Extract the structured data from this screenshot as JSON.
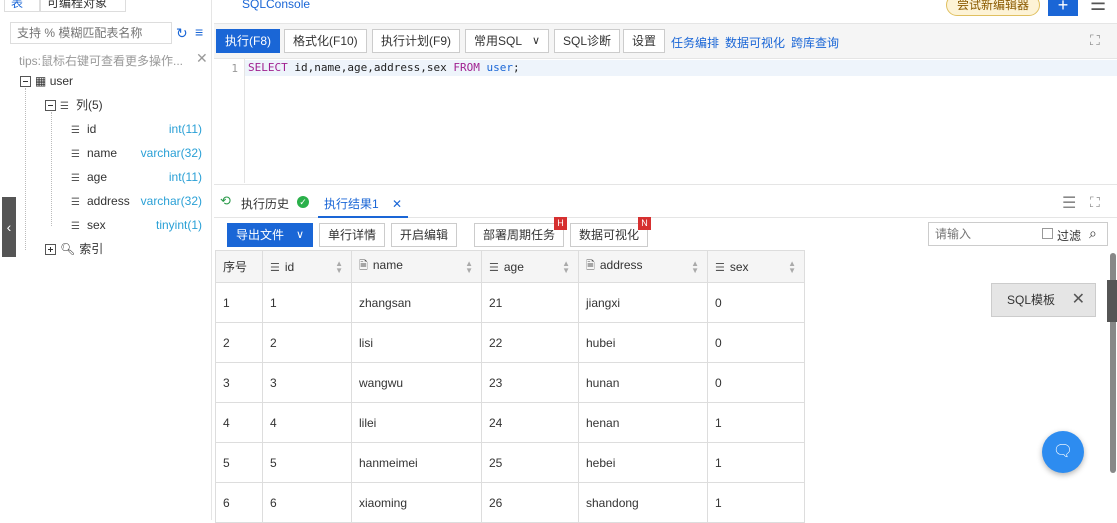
{
  "left_panel": {
    "tabs": [
      "表",
      "可编程对象"
    ],
    "search_placeholder": "支持 % 模糊匹配表名称",
    "tips": "tips:鼠标右键可查看更多操作...",
    "tree": {
      "table": "user",
      "columns_label": "列(5)",
      "columns": [
        {
          "name": "id",
          "type": "int(11)"
        },
        {
          "name": "name",
          "type": "varchar(32)"
        },
        {
          "name": "age",
          "type": "int(11)"
        },
        {
          "name": "address",
          "type": "varchar(32)"
        },
        {
          "name": "sex",
          "type": "tinyint(1)"
        }
      ],
      "index_label": "索引"
    }
  },
  "top": {
    "tab": "SQLConsole",
    "try_button": "尝试新编辑器"
  },
  "toolbar": {
    "run": "执行(F8)",
    "format": "格式化(F10)",
    "plan": "执行计划(F9)",
    "common_sql": "常用SQL",
    "diagnose": "SQL诊断",
    "settings": "设置",
    "links": [
      "任务编排",
      "数据可视化",
      "跨库查询"
    ]
  },
  "editor": {
    "line_number": "1",
    "code_kw1": "SELECT",
    "code_cols": " id,name,age,address,sex ",
    "code_kw2": "FROM",
    "code_table": "user",
    "code_end": ";"
  },
  "results": {
    "history_tab": "执行历史",
    "result_tab": "执行结果1",
    "export": "导出文件",
    "row_detail": "单行详情",
    "start_edit": "开启编辑",
    "deploy": "部署周期任务",
    "deploy_badge": "H",
    "visualize": "数据可视化",
    "visualize_badge": "N",
    "filter_placeholder": "请输入",
    "filter_label": "过滤",
    "headers": [
      "序号",
      "id",
      "name",
      "age",
      "address",
      "sex"
    ],
    "rows": [
      [
        "1",
        "1",
        "zhangsan",
        "21",
        "jiangxi",
        "0"
      ],
      [
        "2",
        "2",
        "lisi",
        "22",
        "hubei",
        "0"
      ],
      [
        "3",
        "3",
        "wangwu",
        "23",
        "hunan",
        "0"
      ],
      [
        "4",
        "4",
        "lilei",
        "24",
        "henan",
        "1"
      ],
      [
        "5",
        "5",
        "hanmeimei",
        "25",
        "hebei",
        "1"
      ],
      [
        "6",
        "6",
        "xiaoming",
        "26",
        "shandong",
        "1"
      ]
    ]
  },
  "floating": {
    "template_label": "SQL模板"
  },
  "colors": {
    "primary": "#1a66d6",
    "type_text": "#2aa0d6",
    "badge": "#d63030"
  }
}
